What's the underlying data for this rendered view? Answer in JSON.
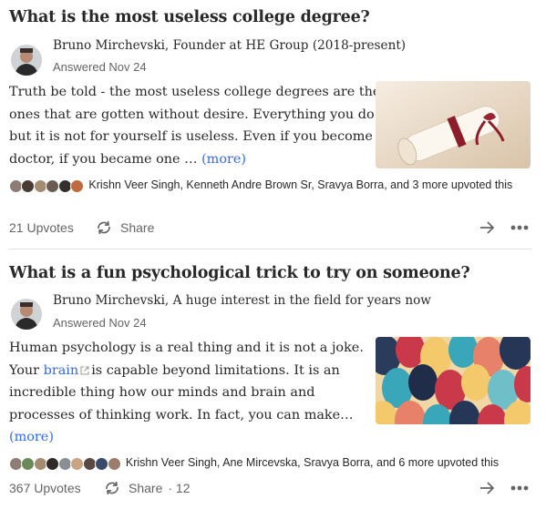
{
  "answers": [
    {
      "question": "What is the most useless college degree?",
      "author_line": "Bruno Mirchevski, Founder at HE Group (2018-present)",
      "answered": "Answered Nov 24",
      "body_lines": [
        "Truth be told - the most useless college degrees are the",
        "ones that are gotten without desire. Everything you do",
        "but it is not for yourself is useless. Even if you become a",
        "doctor, if you became one … "
      ],
      "more": "(more)",
      "upvoters_text": "Krishn Veer Singh, Kenneth Andre Brown Sr, Sravya Borra, and 3 more upvoted this",
      "upvotes": "21 Upvotes",
      "share": "Share",
      "image": "diploma-scroll-image"
    },
    {
      "question": "What is a fun psychological trick to try on someone?",
      "author_line": "Bruno Mirchevski, A huge interest in the field for years now",
      "answered": "Answered Nov 24",
      "body_lines": [
        "Human psychology is a real thing and it is not a joke.",
        "is capable beyond limitations. It is an",
        "incredible thing how our minds and brain and",
        "processes of thinking work. In fact, you can make…"
      ],
      "line2_prefix": "Your ",
      "link_text": "brain",
      "more": "(more)",
      "upvoters_text": "Krishn Veer Singh, Ane Mircevska, Sravya Borra, and 6 more upvoted this",
      "upvotes": "367 Upvotes",
      "share": "Share",
      "share_count": "· 12",
      "image": "colorful-heads-image"
    }
  ],
  "colors": {
    "link": "#2e69ff",
    "muted": "#636466",
    "text": "#282829"
  },
  "icons": [
    "share-icon",
    "downvote-arrow-icon",
    "more-options-icon",
    "external-link-icon"
  ]
}
